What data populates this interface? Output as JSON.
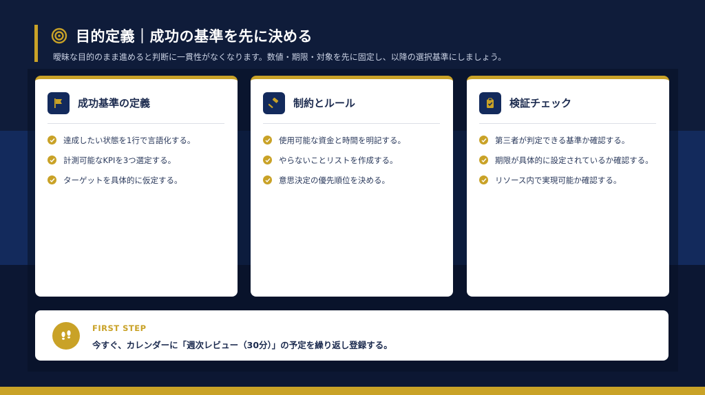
{
  "colors": {
    "accent": "#c9a227",
    "navy": "#132a5c",
    "background": "#0f1c3a",
    "card": "#ffffff"
  },
  "header": {
    "icon": "target-icon",
    "title": "目的定義｜成功の基準を先に決める",
    "subtitle": "曖昧な目的のまま進めると判断に一貫性がなくなります。数値・期限・対象を先に固定し、以降の選択基準にしましょう。"
  },
  "cards": [
    {
      "icon": "flag-icon",
      "title": "成功基準の定義",
      "items": [
        "達成したい状態を1行で言語化する。",
        "計測可能なKPIを3つ選定する。",
        "ターゲットを具体的に仮定する。"
      ]
    },
    {
      "icon": "gavel-icon",
      "title": "制約とルール",
      "items": [
        "使用可能な資金と時間を明記する。",
        "やらないことリストを作成する。",
        "意思決定の優先順位を決める。"
      ]
    },
    {
      "icon": "clipboard-check-icon",
      "title": "検証チェック",
      "items": [
        "第三者が判定できる基準か確認する。",
        "期限が具体的に設定されているか確認する。",
        "リソース内で実現可能か確認する。"
      ]
    }
  ],
  "first_step": {
    "icon": "footsteps-icon",
    "label": "FIRST STEP",
    "text": "今すぐ、カレンダーに「週次レビュー（30分）」の予定を繰り返し登録する。"
  }
}
